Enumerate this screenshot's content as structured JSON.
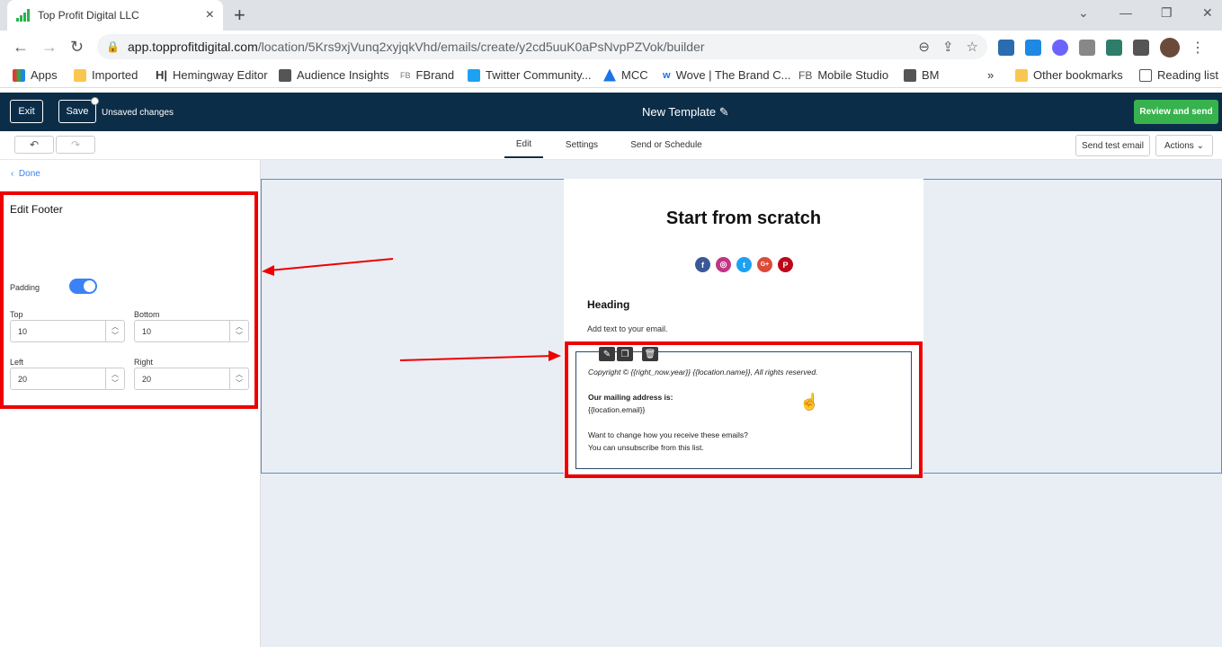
{
  "browser": {
    "tab_title": "Top Profit Digital LLC",
    "tab_close": "×",
    "new_tab": "+",
    "url_host": "app.topprofitdigital.com",
    "url_path": "/location/5Krs9xjVunq2xyjqkVhd/emails/create/y2cd5uuK0aPsNvpPZVok/builder",
    "bookmarks": [
      "Apps",
      "Imported",
      "Hemingway Editor",
      "Audience Insights",
      "FBrand",
      "Twitter Community...",
      "MCC",
      "Wove | The Brand C...",
      "Mobile Studio",
      "BM",
      "»",
      "Other bookmarks",
      "Reading list"
    ],
    "bookmark_prefix_fb1": "FB",
    "bookmark_prefix_fb2": "FB"
  },
  "header": {
    "exit_label": "Exit",
    "save_label": "Save",
    "unsaved_text": "Unsaved changes",
    "template_title": "New Template",
    "review_label": "Review and send"
  },
  "subbar": {
    "tabs": [
      "Edit",
      "Settings",
      "Send or Schedule"
    ],
    "send_test_label": "Send test email",
    "actions_label": "Actions"
  },
  "sidebar": {
    "done_label": "Done",
    "panel_title": "Edit Footer",
    "padding_label": "Padding",
    "padding_enabled": true,
    "top_label": "Top",
    "top_value": "10",
    "bottom_label": "Bottom",
    "bottom_value": "10",
    "left_label": "Left",
    "left_value": "20",
    "right_label": "Right",
    "right_value": "20"
  },
  "email": {
    "title": "Start from scratch",
    "heading": "Heading",
    "add_text": "Add text to your email.",
    "footer_copyright": "Copyright © {{right_now.year}}  {{location.name}}, All rights reserved.",
    "footer_mailing_label": "Our mailing address is:",
    "footer_email": "{{location.email}}",
    "footer_change": "Want to change how you receive these emails?",
    "footer_unsub": "You can unsubscribe from this list."
  },
  "colors": {
    "header_bg": "#0c2d48",
    "review_btn": "#37b24d",
    "highlight": "#e00000",
    "toggle": "#3b82f6"
  }
}
